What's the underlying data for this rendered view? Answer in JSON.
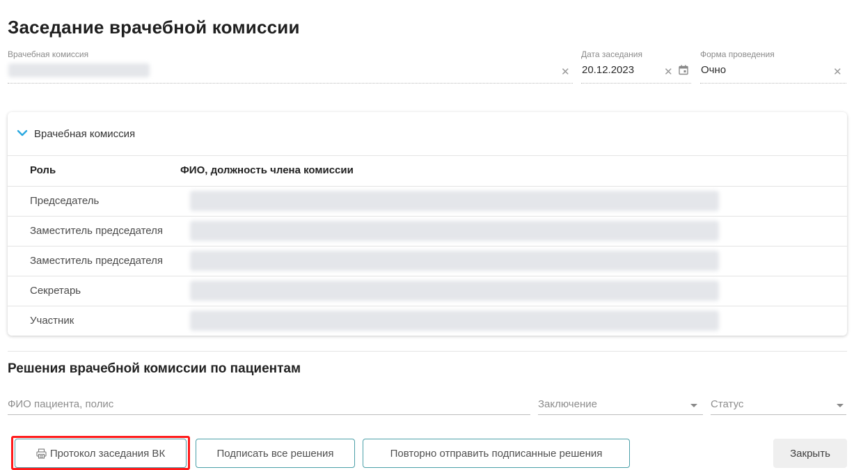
{
  "page": {
    "title": "Заседание врачебной комиссии"
  },
  "form": {
    "commission": {
      "label": "Врачебная комиссия"
    },
    "meeting_date": {
      "label": "Дата заседания",
      "value": "20.12.2023"
    },
    "form_type": {
      "label": "Форма проведения",
      "value": "Очно"
    }
  },
  "commission_panel": {
    "title": "Врачебная комиссия",
    "columns": [
      "Роль",
      "ФИО, должность члена комиссии"
    ],
    "rows": [
      {
        "role": "Председатель"
      },
      {
        "role": "Заместитель председателя"
      },
      {
        "role": "Заместитель председателя"
      },
      {
        "role": "Секретарь"
      },
      {
        "role": "Участник"
      }
    ]
  },
  "decisions": {
    "title": "Решения врачебной комиссии по пациентам",
    "patient_placeholder": "ФИО пациента, полис",
    "conclusion_placeholder": "Заключение",
    "status_placeholder": "Статус"
  },
  "buttons": {
    "protocol": "Протокол заседания ВК",
    "sign_all": "Подписать все решения",
    "resend": "Повторно отправить подписанные решения",
    "close": "Закрыть"
  },
  "icons": {
    "print": "printer-icon",
    "calendar": "calendar-icon",
    "expand": "chevron-down-icon",
    "clear": "close-icon"
  },
  "colors": {
    "accent": "#4a9fa8",
    "chevron": "#29a8e0",
    "highlight": "#ff1a1a"
  }
}
